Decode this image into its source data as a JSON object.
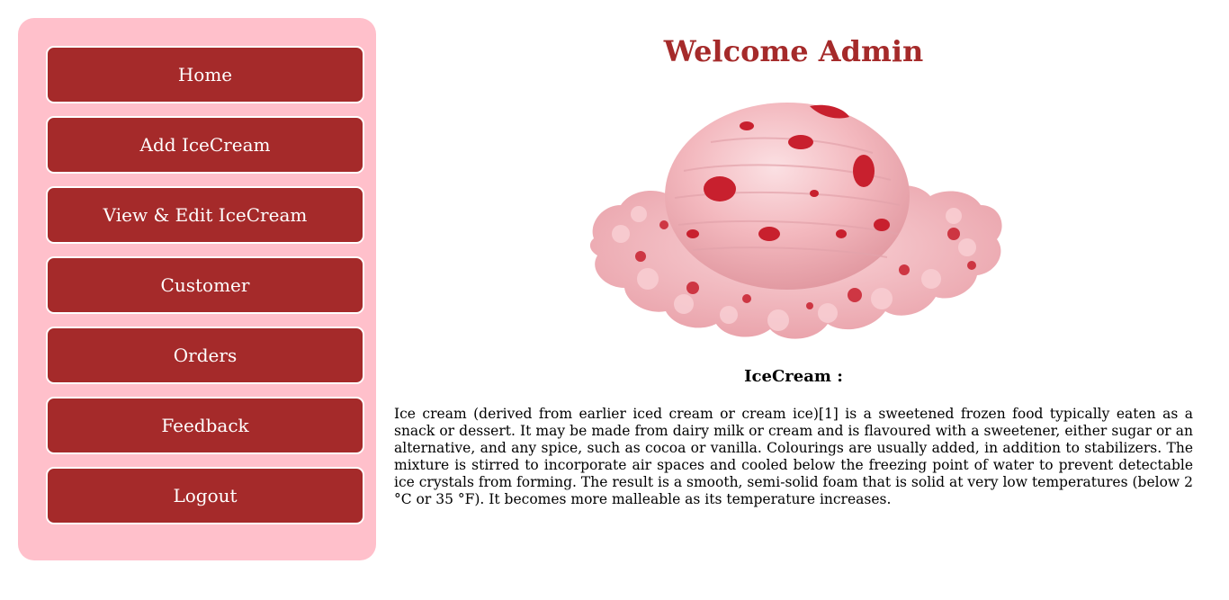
{
  "sidebar": {
    "items": [
      {
        "label": "Home"
      },
      {
        "label": "Add IceCream"
      },
      {
        "label": "View & Edit IceCream"
      },
      {
        "label": "Customer"
      },
      {
        "label": "Orders"
      },
      {
        "label": "Feedback"
      },
      {
        "label": "Logout"
      }
    ]
  },
  "main": {
    "title": "Welcome Admin",
    "hero_image": "strawberry-ice-cream-scoop",
    "section_heading": "IceCream :",
    "description": "Ice cream (derived from earlier iced cream or cream ice)[1] is a sweetened frozen food typically eaten as a snack or dessert. It may be made from dairy milk or cream and is flavoured with a sweetener, either sugar or an alternative, and any spice, such as cocoa or vanilla. Colourings are usually added, in addition to stabilizers. The mixture is stirred to incorporate air spaces and cooled below the freezing point of water to prevent detectable ice crystals from forming. The result is a smooth, semi-solid foam that is solid at very low temperatures (below 2 °C or 35 °F). It becomes more malleable as its temperature increases."
  },
  "colors": {
    "accent": "#a52a2a",
    "sidebar_bg": "#ffc0cb",
    "background": "#ffffff"
  }
}
